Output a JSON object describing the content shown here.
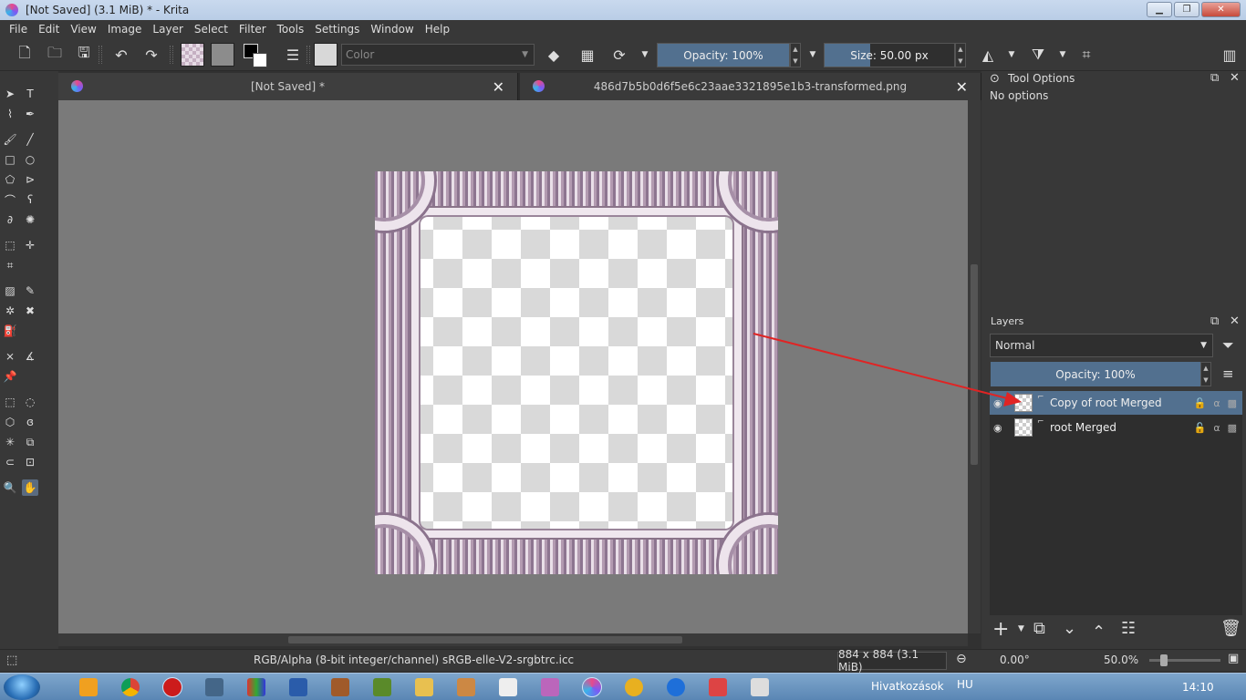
{
  "window": {
    "title": "[Not Saved]  (3.1 MiB)  * - Krita",
    "minimize": "▁",
    "maximize": "❐",
    "close": "✕"
  },
  "menu": [
    "File",
    "Edit",
    "View",
    "Image",
    "Layer",
    "Select",
    "Filter",
    "Tools",
    "Settings",
    "Window",
    "Help"
  ],
  "toolbar": {
    "blend_placeholder": "Color",
    "opacity_label": "Opacity: 100%",
    "opacity_value": 1.0,
    "size_label": "Size: 50.00 px",
    "size_fraction": 0.35
  },
  "tabs": [
    {
      "title": "[Not Saved]  *"
    },
    {
      "title": "486d7b5b0d6f5e6c23aae3321895e1b3-transformed.png"
    }
  ],
  "tool_options": {
    "title": "Tool Options",
    "body": "No options"
  },
  "layers_panel": {
    "title": "Layers",
    "blend_mode": "Normal",
    "opacity_label": "Opacity:  100%",
    "layers": [
      {
        "name": "Copy of root Merged",
        "selected": true
      },
      {
        "name": "root Merged",
        "selected": false
      }
    ]
  },
  "status": {
    "color_profile": "RGB/Alpha (8-bit integer/channel)  sRGB-elle-V2-srgbtrc.icc",
    "image_size": "884 x 884 (3.1 MiB)",
    "rotation": "0.00°",
    "zoom": "50.0%"
  },
  "taskbar": {
    "shortcuts_label": "Hivatkozások",
    "language": "HU",
    "time": "14:10"
  },
  "colors": {
    "accent": "#52708f",
    "annotation_arrow": "#e02424",
    "canvas_bg": "#7a7a7a"
  }
}
